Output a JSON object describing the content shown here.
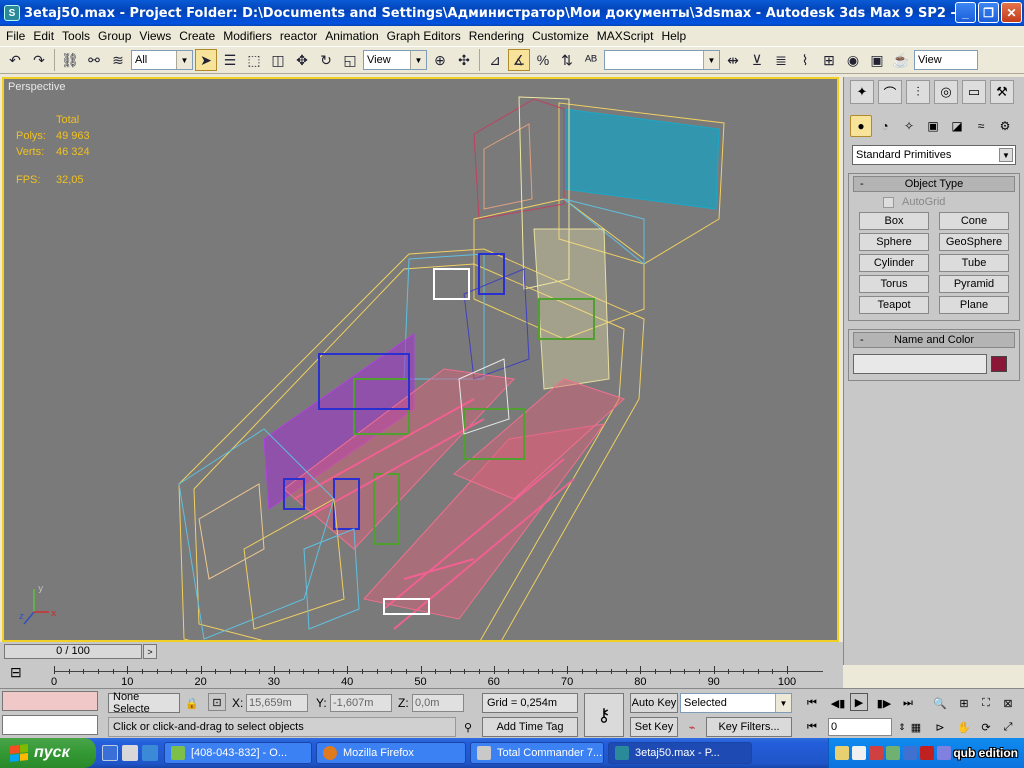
{
  "window": {
    "title": "3etaj50.max   - Project Folder: D:\\Documents and Settings\\Администратор\\Мои документы\\3dsmax    - Autodesk 3ds Max 9 SP2    - Display : ...",
    "app_icon": "3ds-max-icon"
  },
  "menu": [
    "File",
    "Edit",
    "Tools",
    "Group",
    "Views",
    "Create",
    "Modifiers",
    "reactor",
    "Animation",
    "Graph Editors",
    "Rendering",
    "Customize",
    "MAXScript",
    "Help"
  ],
  "toolbar": {
    "selection_filter": "All",
    "ref_coord": "View",
    "named_selection": "",
    "right_view": "View"
  },
  "viewport": {
    "label": "Perspective",
    "stats_header": "Total",
    "polys_label": "Polys:",
    "polys_value": "49 963",
    "verts_label": "Verts:",
    "verts_value": "46 324",
    "fps_label": "FPS:",
    "fps_value": "32,05"
  },
  "command_panel": {
    "category": "Standard Primitives",
    "object_type_title": "Object Type",
    "autogrid_label": "AutoGrid",
    "buttons": [
      "Box",
      "Cone",
      "Sphere",
      "GeoSphere",
      "Cylinder",
      "Tube",
      "Torus",
      "Pyramid",
      "Teapot",
      "Plane"
    ],
    "name_color_title": "Name and Color",
    "object_name": "",
    "object_color": "#8a1638",
    "minus": "-"
  },
  "time": {
    "slider_label": "0 / 100",
    "ticks": [
      "0",
      "10",
      "20",
      "30",
      "40",
      "50",
      "60",
      "70",
      "80",
      "90",
      "100"
    ]
  },
  "status": {
    "selection": "None Selecte",
    "x_label": "X:",
    "x_value": "15,659m",
    "y_label": "Y:",
    "y_value": "-1,607m",
    "z_label": "Z:",
    "z_value": "0,0m",
    "grid": "Grid = 0,254m",
    "prompt": "Click or click-and-drag to select objects",
    "add_time_tag": "Add Time Tag",
    "auto_key": "Auto Key",
    "set_key": "Set Key",
    "key_mode": "Selected",
    "key_filters": "Key Filters...",
    "frame": "0"
  },
  "taskbar": {
    "start_label": "пуск",
    "tasks": [
      {
        "label": "[408-043-832] - О...",
        "color": "#7cc04a"
      },
      {
        "label": "Mozilla Firefox",
        "color": "#e07a1f"
      },
      {
        "label": "Total Commander 7...",
        "color": "#c9c9c9"
      },
      {
        "label": "3etaj50.max - P...",
        "color": "#2a8a9a"
      }
    ],
    "watermark": "qub edition"
  }
}
